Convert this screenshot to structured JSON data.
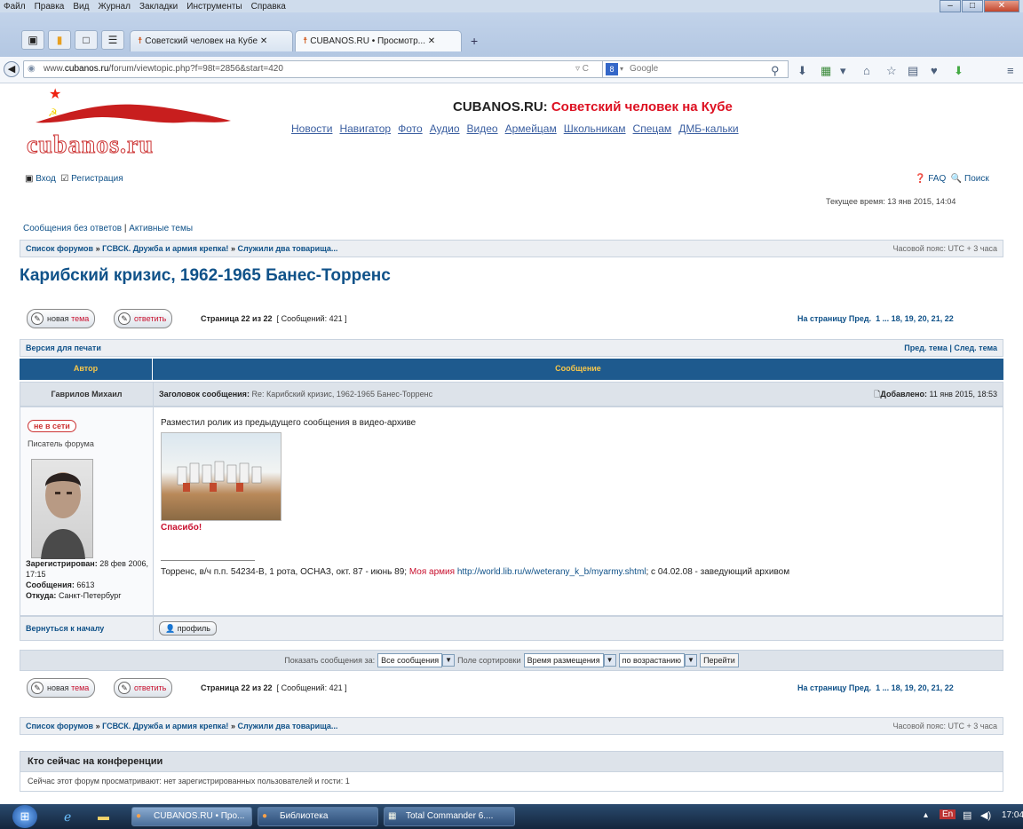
{
  "browser": {
    "menu": [
      "Файл",
      "Правка",
      "Вид",
      "Журнал",
      "Закладки",
      "Инструменты",
      "Справка"
    ],
    "tabs": [
      "Советский человек на Кубе",
      "CUBANOS.RU • Просмотр..."
    ],
    "new_tab": "+",
    "url_prefix": "www.",
    "url_domain": "cubanos.ru",
    "url_path": "/forum/viewtopic.php?f=98t=2856&start=420",
    "search_engine": "Google",
    "win_min": "–",
    "win_max": "□",
    "win_close": "✕"
  },
  "site": {
    "logo_text": "cubanos.ru",
    "title_prefix": "CUBANOS.RU:",
    "title_suffix": "Советский человек на Кубе",
    "nav": [
      "Новости",
      "Навигатор",
      "Фото",
      "Аудио",
      "Видео",
      "Армейцам",
      "Школьникам",
      "Спецам",
      "ДМБ-кальки"
    ]
  },
  "userbar": {
    "login": "Вход",
    "register": "Регистрация",
    "faq": "FAQ",
    "search": "Поиск"
  },
  "current_time": "Текущее время: 13 янв 2015, 14:04",
  "quicklinks": {
    "unanswered": "Сообщения без ответов",
    "sep": "|",
    "active": "Активные темы"
  },
  "breadcrumb": {
    "items": [
      "Список форумов",
      "ГСВСК. Дружба и армия крепка!",
      "Служили два товарища..."
    ],
    "sep": "»",
    "timezone": "Часовой пояс: UTC + 3 часа"
  },
  "topic_title": "Карибский кризис, 1962-1965 Банес-Торренс",
  "actions": {
    "new_topic_a": "новая",
    "new_topic_b": "тема",
    "reply": "ответить",
    "page_info": "Страница 22 из 22",
    "post_count": "[ Сообщений: 421 ]",
    "pagination_label": "На страницу Пред.",
    "pagination": "1 ... 18, 19, 20, 21, 22"
  },
  "topbar": {
    "print": "Версия для печати",
    "prev_next": "Пред. тема | След. тема"
  },
  "table": {
    "col_author": "Автор",
    "col_message": "Сообщение"
  },
  "post": {
    "author": "Гаврилов Михаил",
    "subject_label": "Заголовок сообщения:",
    "subject": "Re: Карибский кризис, 1962-1965 Банес-Торренс",
    "posted_label": "Добавлено:",
    "posted": "11 янв 2015, 18:53",
    "status": "не в сети",
    "rank": "Писатель форума",
    "registered_label": "Зарегистрирован:",
    "registered": "28 фев 2006, 17:15",
    "messages_label": "Сообщения:",
    "messages": "6613",
    "from_label": "Откуда:",
    "from": "Санкт-Петербург",
    "body": "Разместил ролик из предыдущего сообщения в видео-архиве",
    "thanks": "Спасибо!",
    "sig_text": "Торренс, в/ч п.п. 54234-В, 1 рота, ОСНАЗ, окт. 87 - июнь 89;",
    "sig_link_label": "Моя армия",
    "sig_url": "http://world.lib.ru/w/weterany_k_b/myarmy.shtml",
    "sig_tail": "; с 04.02.08 - заведующий архивом",
    "back_to_top": "Вернуться к началу",
    "profile": "профиль"
  },
  "sortbar": {
    "show_label": "Показать сообщения за:",
    "show_value": "Все сообщения",
    "sort_label": "Поле сортировки",
    "sort_value": "Время размещения",
    "order_value": "по возрастанию",
    "go": "Перейти"
  },
  "online": {
    "header": "Кто сейчас на конференции",
    "text": "Сейчас этот форум просматривают: нет зарегистрированных пользователей и гости: 1"
  },
  "taskbar": {
    "items": [
      "CUBANOS.RU • Про...",
      "Библиотека",
      "Total Commander 6...."
    ],
    "lang": "En",
    "clock": "17:04"
  }
}
